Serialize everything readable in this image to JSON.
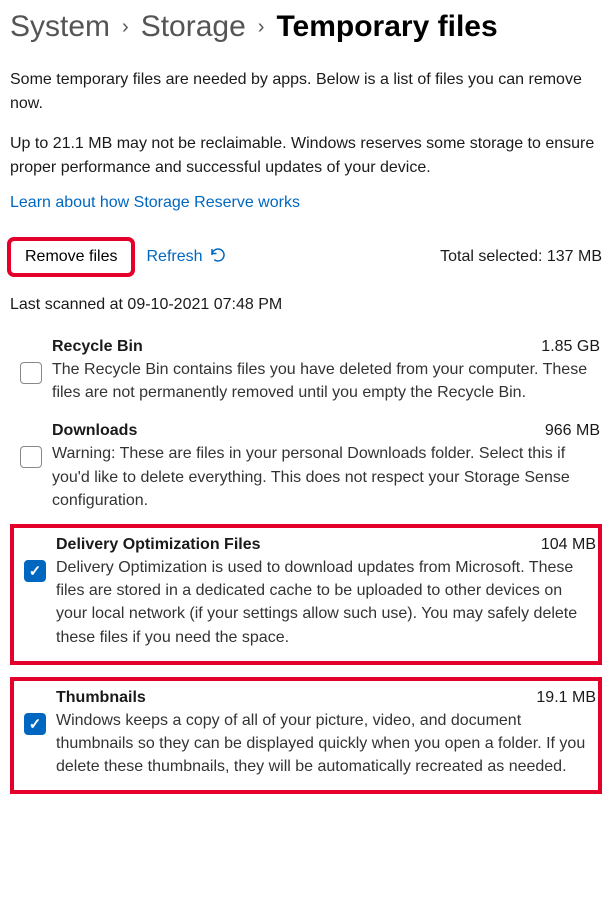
{
  "breadcrumb": {
    "system": "System",
    "storage": "Storage",
    "current": "Temporary files"
  },
  "intro1": "Some temporary files are needed by apps. Below is a list of files you can remove now.",
  "intro2": "Up to 21.1 MB may not be reclaimable. Windows reserves some storage to ensure proper performance and successful updates of your device.",
  "learn_link": "Learn about how Storage Reserve works",
  "actions": {
    "remove": "Remove files",
    "refresh": "Refresh",
    "total_label": "Total selected:",
    "total_value": "137 MB"
  },
  "scanned": "Last scanned at 09-10-2021 07:48 PM",
  "items": [
    {
      "title": "Recycle Bin",
      "size": "1.85 GB",
      "desc": "The Recycle Bin contains files you have deleted from your computer. These files are not permanently removed until you empty the Recycle Bin.",
      "checked": false,
      "highlight": false
    },
    {
      "title": "Downloads",
      "size": "966 MB",
      "desc": "Warning: These are files in your personal Downloads folder. Select this if you'd like to delete everything. This does not respect your Storage Sense configuration.",
      "checked": false,
      "highlight": false
    },
    {
      "title": "Delivery Optimization Files",
      "size": "104 MB",
      "desc": "Delivery Optimization is used to download updates from Microsoft. These files are stored in a dedicated cache to be uploaded to other devices on your local network (if your settings allow such use). You may safely delete these files if you need the space.",
      "checked": true,
      "highlight": true
    },
    {
      "title": "Thumbnails",
      "size": "19.1 MB",
      "desc": "Windows keeps a copy of all of your picture, video, and document thumbnails so they can be displayed quickly when you open a folder. If you delete these thumbnails, they will be automatically recreated as needed.",
      "checked": true,
      "highlight": true
    }
  ]
}
